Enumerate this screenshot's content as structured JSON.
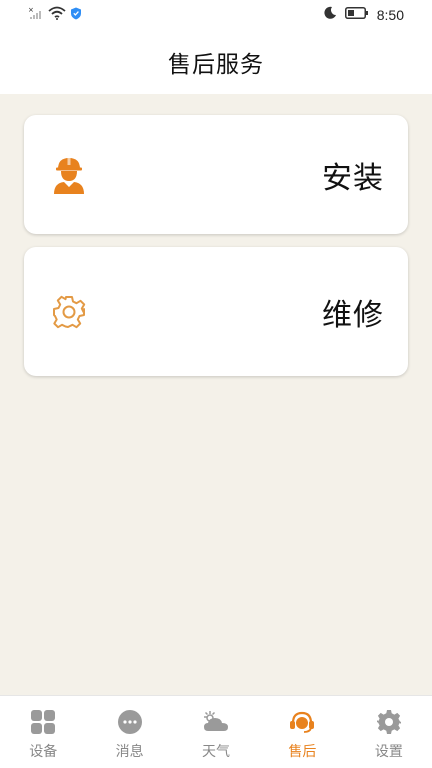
{
  "status_bar": {
    "time": "8:50",
    "icons": [
      "signal-icon",
      "wifi-icon",
      "shield-icon",
      "moon-icon",
      "battery-icon"
    ]
  },
  "header": {
    "title": "售后服务"
  },
  "cards": [
    {
      "label": "安装",
      "icon": "worker-icon"
    },
    {
      "label": "维修",
      "icon": "gear-icon"
    }
  ],
  "bottom_nav": {
    "active_index": 3,
    "items": [
      {
        "label": "设备",
        "icon": "grid-icon"
      },
      {
        "label": "消息",
        "icon": "chat-icon"
      },
      {
        "label": "天气",
        "icon": "weather-icon"
      },
      {
        "label": "售后",
        "icon": "headset-icon"
      },
      {
        "label": "设置",
        "icon": "settings-icon"
      }
    ]
  },
  "colors": {
    "accent": "#e8821e",
    "background": "#f4f1e9",
    "inactive": "#9a9a9a"
  }
}
